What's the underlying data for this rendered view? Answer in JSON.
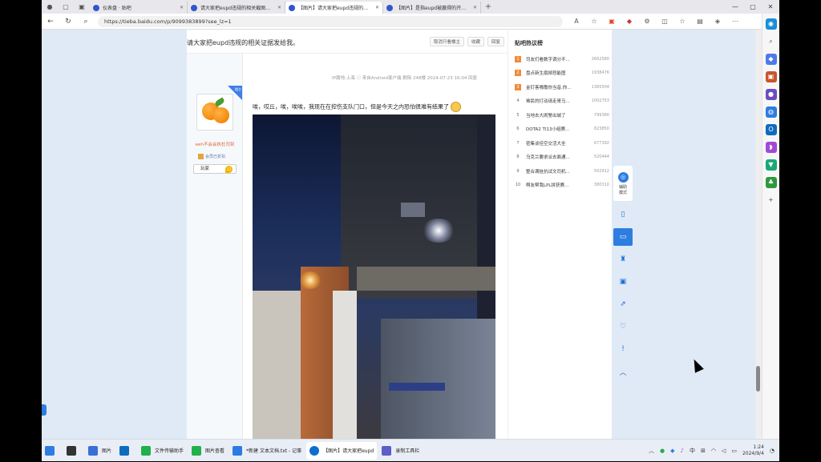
{
  "browser": {
    "tabs": [
      {
        "label": "仪表盘 · 贴吧"
      },
      {
        "label": "请大家把eupd违规的相关截图发给我。"
      },
      {
        "label": "【图片】请大家把eupd违规的相关..."
      },
      {
        "label": "【图片】是指eupd被赢得的开玩笑..."
      }
    ],
    "new_tab": "+",
    "url": "https://tieba.baidu.com/p/9099383899?see_lz=1"
  },
  "post": {
    "title": "请大家把eupd违规的相关证据发给我。",
    "buttons": [
      "取消只看楼主",
      "收藏",
      "回复"
    ],
    "meta": "IP属地:上海 ⓘ 来自Android客户端 删除 248楼 2024-07-23 16:04 回复",
    "text": "唉，哎丘，唉，唉唉，我现在在控伤支队门口，但是今天之内恐怕很难有结果了",
    "author": {
      "name": "eeh不会会执杜司刻",
      "badge": "会员已折扣",
      "level_label": "玩家",
      "level": "13",
      "ribbon": "楼主"
    }
  },
  "sidebar": {
    "title": "贴吧热议榜",
    "items": [
      {
        "rank": "1",
        "name": "司友们看数字调分不...",
        "count": "2662580"
      },
      {
        "rank": "2",
        "name": "盘点新生扇掉怒能图",
        "count": "1938476"
      },
      {
        "rank": "3",
        "name": "金钉客嘴敬你当音,你...",
        "count": "1365504"
      },
      {
        "rank": "4",
        "name": "难民的打动请走哥马...",
        "count": "1002753"
      },
      {
        "rank": "5",
        "name": "当地去大闹警出城了",
        "count": "799380"
      },
      {
        "rank": "6",
        "name": "DOTA2 TI13小组赛...",
        "count": "823850"
      },
      {
        "rank": "7",
        "name": "密集谈佳空交活大全",
        "count": "677392"
      },
      {
        "rank": "8",
        "name": "乌克兰要求派去面通...",
        "count": "520444"
      },
      {
        "rank": "9",
        "name": "整合满娃抗试文司机...",
        "count": "502912"
      },
      {
        "rank": "10",
        "name": "啊友帮我LPL拼获赛...",
        "count": "380310"
      }
    ]
  },
  "floatbar": {
    "help_label": "辅助模式"
  },
  "taskbar": {
    "items": [
      {
        "label": "图片",
        "color": "#3a6fd8"
      },
      {
        "label": "",
        "color": "#0f6cbd"
      },
      {
        "label": "文件传输助手",
        "color": "#21b14a"
      },
      {
        "label": "图片查看",
        "color": "#21b14a"
      },
      {
        "label": "*新建 文本文档.txt - 记事",
        "color": "#2c7be5"
      },
      {
        "label": "【图片】请大家把eupd",
        "color": "#0b6fcf"
      },
      {
        "label": "录制工具栏",
        "color": "#5b5fc7"
      }
    ],
    "time": "1:24",
    "date": "2024/9/4",
    "ime": "中"
  }
}
